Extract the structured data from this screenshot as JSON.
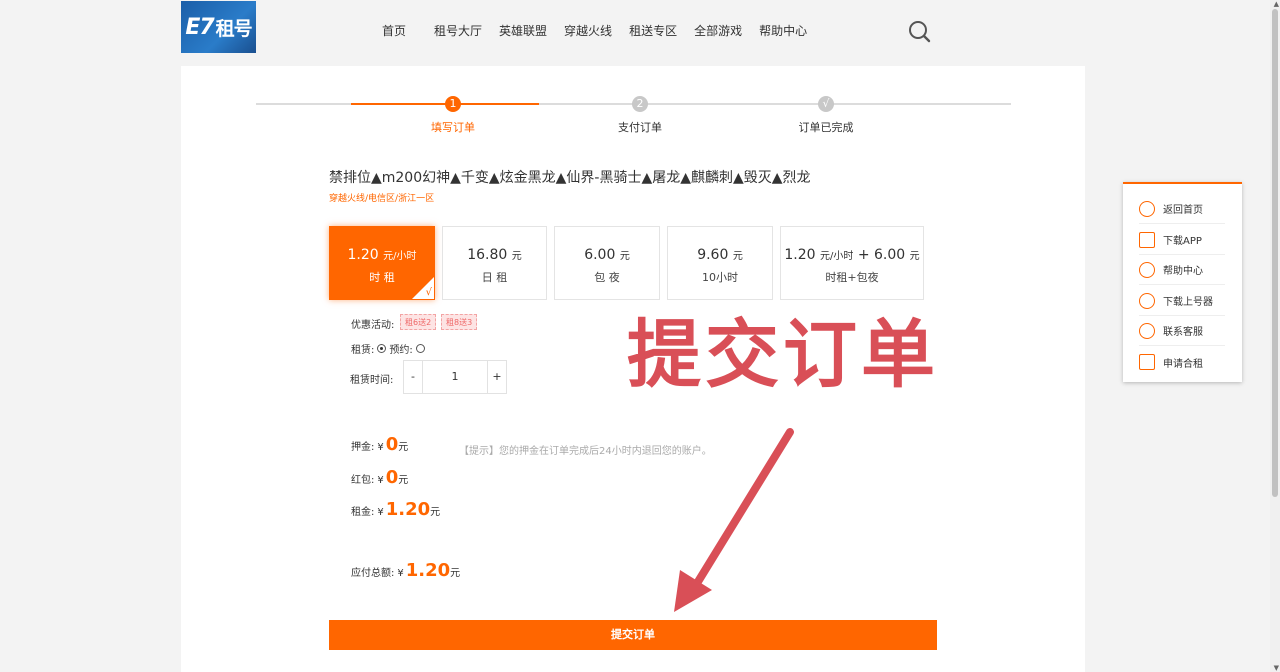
{
  "header": {
    "logo_prefix": "E7",
    "logo_text": "租号",
    "nav": [
      "首页",
      "租号大厅",
      "英雄联盟",
      "穿越火线",
      "租送专区",
      "全部游戏",
      "帮助中心"
    ]
  },
  "steps": [
    {
      "num": "1",
      "label": "填写订单",
      "active": true
    },
    {
      "num": "2",
      "label": "支付订单",
      "active": false
    },
    {
      "num": "√",
      "label": "订单已完成",
      "active": false
    }
  ],
  "product": {
    "title": "禁排位▲m200幻神▲千变▲炫金黑龙▲仙界-黑骑士▲屠龙▲麒麟刺▲毁灭▲烈龙",
    "region": "穿越火线/电信区/浙江一区"
  },
  "options": [
    {
      "price": "1.20",
      "unit": "元/小时",
      "type": "时 租",
      "selected": true
    },
    {
      "price": "16.80",
      "unit": "元",
      "type": "日 租"
    },
    {
      "price": "6.00",
      "unit": "元",
      "type": "包 夜"
    },
    {
      "price": "9.60",
      "unit": "元",
      "type": "10小时"
    },
    {
      "price": "1.20",
      "unit": "元/小时",
      "plus": "+ 6.00",
      "unit2": "元",
      "type": "时租+包夜"
    }
  ],
  "form": {
    "promo_label": "优惠活动:",
    "promos": [
      "租6送2",
      "租8送3"
    ],
    "rent_label": "租赁:",
    "rent_mode_label": "预约:",
    "duration_label": "租赁时间:",
    "minus": "-",
    "plus": "+",
    "duration": "1"
  },
  "summary": {
    "currency": "¥",
    "unit": "元",
    "deposit_label": "押金:",
    "deposit": "0",
    "deposit_hint": "【提示】您的押金在订单完成后24小时内退回您的账户。",
    "redpacket_label": "红包:",
    "redpacket": "0",
    "rent_label": "租金:",
    "rent": "1.20",
    "total_label": "应付总额:",
    "total": "1.20"
  },
  "submit_label": "提交订单",
  "annotation": "提交订单",
  "sidebar": [
    "返回首页",
    "下载APP",
    "帮助中心",
    "下载上号器",
    "联系客服",
    "申请合租"
  ],
  "colors": {
    "accent": "#ff6600",
    "annotation": "#d94f57"
  }
}
